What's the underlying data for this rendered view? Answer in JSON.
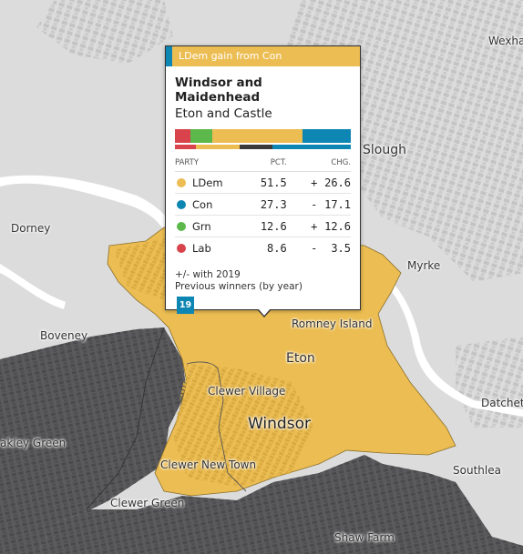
{
  "map": {
    "places": [
      {
        "key": "slough",
        "label": "Slough"
      },
      {
        "key": "wexham",
        "label": "Wexha"
      },
      {
        "key": "dorney",
        "label": "Dorney"
      },
      {
        "key": "myrke",
        "label": "Myrke"
      },
      {
        "key": "romney",
        "label": "Romney Island"
      },
      {
        "key": "boveney",
        "label": "Boveney"
      },
      {
        "key": "eton",
        "label": "Eton"
      },
      {
        "key": "clewer_village",
        "label": "Clewer Village"
      },
      {
        "key": "windsor",
        "label": "Windsor"
      },
      {
        "key": "datchet",
        "label": "Datchet"
      },
      {
        "key": "oakley",
        "label": "akley Green"
      },
      {
        "key": "clewer_new",
        "label": "Clewer New Town"
      },
      {
        "key": "southlea",
        "label": "Southlea"
      },
      {
        "key": "clewer_green",
        "label": "Clewer Green"
      },
      {
        "key": "shaw_farm",
        "label": "Shaw Farm"
      }
    ],
    "colors": {
      "land": "#dcdcdc",
      "river": "#ffffff",
      "selected_ward": "#ecbd52",
      "other_wards": "#5b5b5d"
    }
  },
  "popup": {
    "header_label": "LDem gain from Con",
    "header_color": "#ecbd52",
    "header_strip_color": "#0e86b3",
    "title": "Windsor and Maidenhead",
    "subtitle": "Eton and Castle",
    "columns": {
      "party": "PARTY",
      "pct": "PCT.",
      "chg": "CHG."
    },
    "rows": [
      {
        "party": "LDem",
        "pct": "51.5",
        "sign": "+",
        "chg": "26.6",
        "color": "#ecbd52"
      },
      {
        "party": "Con",
        "pct": "27.3",
        "sign": "-",
        "chg": "17.1",
        "color": "#0e86b3"
      },
      {
        "party": "Grn",
        "pct": "12.6",
        "sign": "+",
        "chg": "12.6",
        "color": "#5cb84a"
      },
      {
        "party": "Lab",
        "pct": "8.6",
        "sign": "-",
        "chg": "3.5",
        "color": "#d9434b"
      }
    ],
    "current_bar": [
      {
        "party": "Lab",
        "share": 8.6,
        "color": "#d9434b"
      },
      {
        "party": "Grn",
        "share": 12.6,
        "color": "#5cb84a"
      },
      {
        "party": "LDem",
        "share": 51.5,
        "color": "#ecbd52"
      },
      {
        "party": "Con",
        "share": 27.3,
        "color": "#0e86b3"
      }
    ],
    "previous_bar": [
      {
        "party": "Lab",
        "share": 12.1,
        "color": "#d9434b"
      },
      {
        "party": "LDem",
        "share": 24.9,
        "color": "#ecbd52"
      },
      {
        "party": "Other",
        "share": 18.6,
        "color": "#3a3a3a"
      },
      {
        "party": "Con",
        "share": 44.4,
        "color": "#0e86b3"
      }
    ],
    "change_note": "+/- with 2019",
    "winners_label": "Previous winners (by year)",
    "winners": [
      {
        "year": "19",
        "color": "#0e86b3"
      }
    ]
  }
}
